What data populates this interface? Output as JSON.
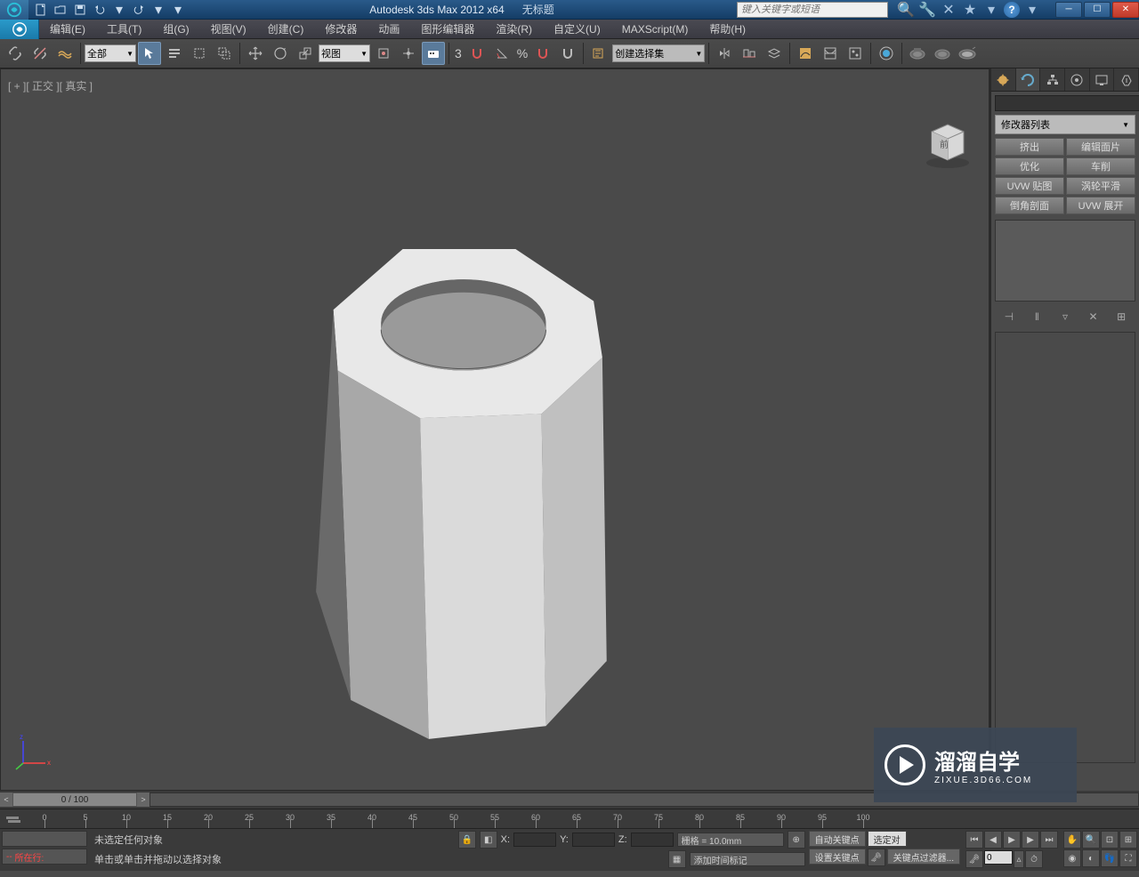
{
  "title": {
    "app": "Autodesk 3ds Max  2012 x64",
    "doc": "无标题"
  },
  "search_placeholder": "键入关键字或短语",
  "menus": {
    "edit": "编辑(E)",
    "tools": "工具(T)",
    "group": "组(G)",
    "views": "视图(V)",
    "create": "创建(C)",
    "modifiers": "修改器",
    "animation": "动画",
    "graph": "图形编辑器",
    "rendering": "渲染(R)",
    "customize": "自定义(U)",
    "maxscript": "MAXScript(M)",
    "help": "帮助(H)"
  },
  "toolbar": {
    "filter_all": "全部",
    "view_dd": "视图",
    "selset_dd": "创建选择集",
    "three": "3",
    "percent": "%"
  },
  "viewport": {
    "label": "[ + ][ 正交 ][ 真实 ]",
    "cube_face": "前"
  },
  "cmdpanel": {
    "modlist": "修改器列表",
    "buttons": [
      "挤出",
      "编辑面片",
      "优化",
      "车削",
      "UVW 贴图",
      "涡轮平滑",
      "倒角剖面",
      "UVW 展开"
    ]
  },
  "timeline": {
    "slider": "0 / 100",
    "ticks": [
      0,
      5,
      10,
      15,
      20,
      25,
      30,
      35,
      40,
      45,
      50,
      55,
      60,
      65,
      70,
      75,
      80,
      85,
      90,
      95,
      100
    ]
  },
  "status": {
    "row_label": "所在行:",
    "no_selection": "未选定任何对象",
    "prompt": "单击或单击并拖动以选择对象",
    "x": "X:",
    "y": "Y:",
    "z": "Z:",
    "grid": "栅格 = 10.0mm",
    "add_time_tag": "添加时间标记",
    "auto_key": "自动关键点",
    "sel_locked": "选定对",
    "set_key": "设置关键点",
    "key_filter": "关键点过滤器...",
    "frame": "0"
  },
  "watermark": {
    "brand": "溜溜自学",
    "url": "ZIXUE.3D66.COM"
  }
}
